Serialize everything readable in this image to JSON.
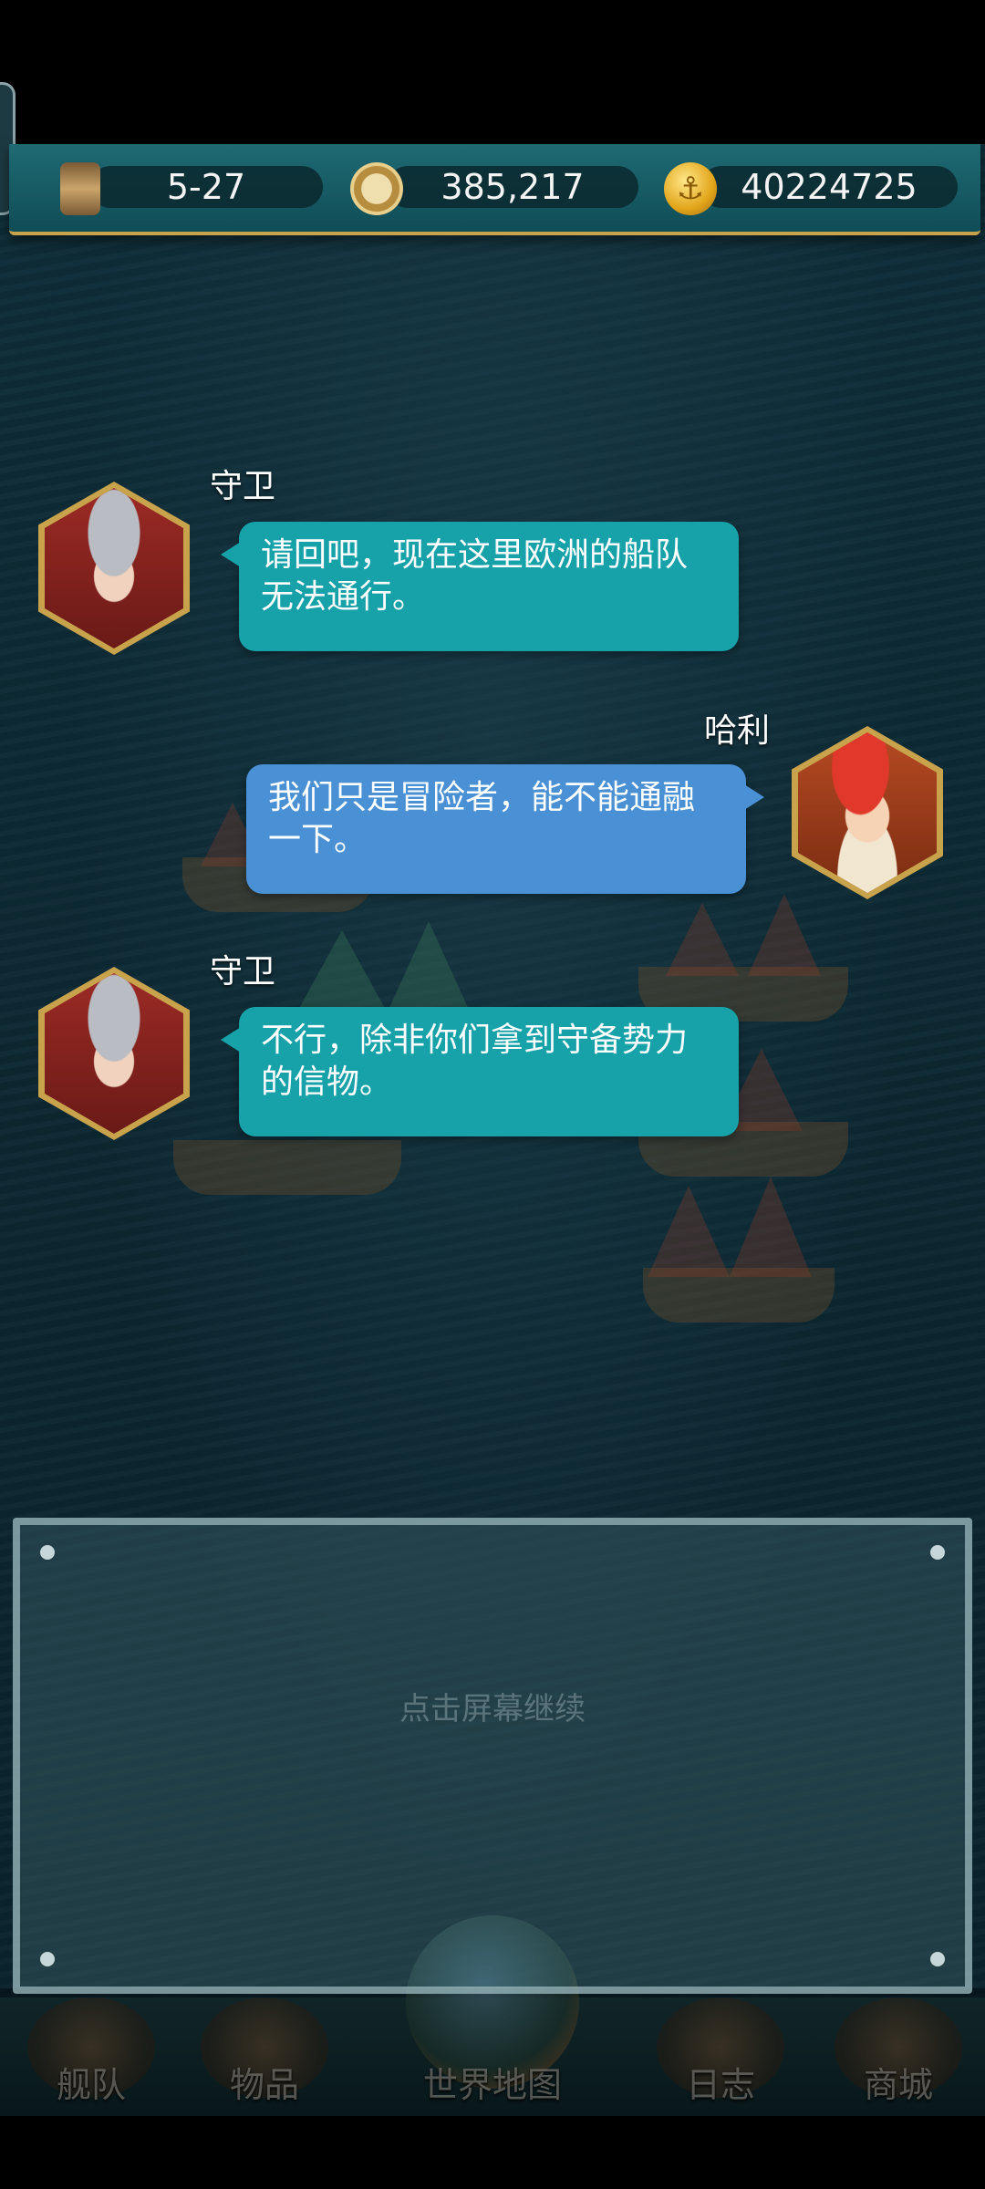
{
  "resources": {
    "date": "5-27",
    "fame": "385,217",
    "gold": "40224725"
  },
  "dialogue": [
    {
      "speaker": "守卫",
      "text": "请回吧，现在这里欧洲的船队无法通行。"
    },
    {
      "speaker": "哈利",
      "text": "我们只是冒险者，能不能通融一下。"
    },
    {
      "speaker": "守卫",
      "text": "不行，除非你们拿到守备势力的信物。"
    }
  ],
  "panel": {
    "hint": "点击屏幕继续"
  },
  "nav": {
    "fleet": "舰队",
    "items": "物品",
    "world_map": "世界地图",
    "log": "日志",
    "shop": "商城"
  },
  "icons": {
    "date": "hourglass-icon",
    "fame": "compass-icon",
    "gold": "anchor-coin-icon"
  }
}
